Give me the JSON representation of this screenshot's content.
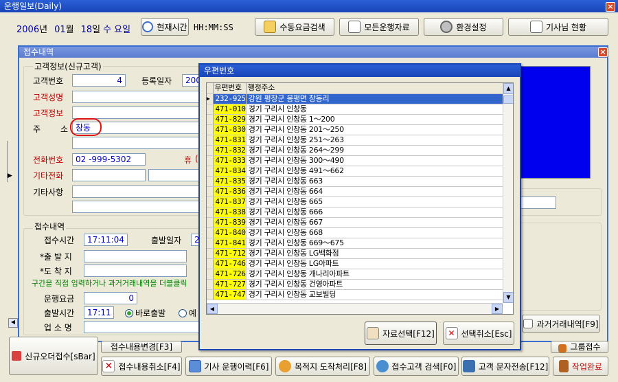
{
  "main_window": {
    "title": "운행일보(Daily)",
    "date": {
      "year": "2006",
      "year_unit": "년",
      "month": "01",
      "month_unit": "월",
      "day": "18",
      "day_unit": "일",
      "weekday": "수 요일"
    },
    "current_time_button": "현재시간",
    "time_display": "HH:MM:SS",
    "toolbar": [
      {
        "label": "수동요금검색",
        "icon": "wand-icon"
      },
      {
        "label": "모든운행자료",
        "icon": "document-icon"
      },
      {
        "label": "환경설정",
        "icon": "gear-icon"
      },
      {
        "label": "기사님 현황",
        "icon": "clipboard-icon"
      }
    ]
  },
  "reception_window": {
    "title": "접수내역",
    "customer_group": {
      "title": "고객정보(신규고객)",
      "customer_no_label": "고객번호",
      "customer_no": "4",
      "reg_date_label": "등록일자",
      "reg_date": "200",
      "name_label": "고객성명",
      "info_label": "고객정보",
      "address_label_a": "주",
      "address_label_b": "소",
      "address_value": "창동",
      "phone_label": "전화번호",
      "phone_value": "02  -999-5302",
      "mobile_label_partial": "휴",
      "mobile_value_partial": "(",
      "other_phone_label": "기타전화",
      "other_notes_label": "기타사항"
    },
    "reception_group": {
      "title": "접수내역",
      "time_label": "접수시간",
      "time_value": "17:11:04",
      "depart_date_label": "출발일자",
      "depart_date_partial": "2",
      "origin_label": "*출 발 지",
      "destination_label": "*도 착 지",
      "hint_text": "구간을 직접 입력하거나 과거거래내역을 더블클릭",
      "fare_label": "운행요금",
      "fare_value": "0",
      "depart_time_label": "출발시간",
      "depart_time_value": "17:11",
      "radio_now": "바로출발",
      "radio_reserve_partial": "예",
      "business_label": "업 소 명"
    },
    "history_button": "과거거래내역[F9]"
  },
  "bottom_bar": {
    "new_order": "신규오더접수[sBar]",
    "buttons_row1": [
      "접수내용변경[F3]",
      "그룹접수"
    ],
    "buttons_row2": [
      {
        "label": "접수내용취소[F4]",
        "icon": "cancel-icon"
      },
      {
        "label": "기사 운행이력[F6]",
        "icon": "calendar-icon"
      },
      {
        "label": "목적지 도착처리[F8]",
        "icon": "phone-icon"
      },
      {
        "label": "접수고객 검색[F0]",
        "icon": "search-person-icon"
      },
      {
        "label": "고객 문자전송[F12]",
        "icon": "message-icon"
      },
      {
        "label": "작업완료",
        "icon": "door-icon"
      }
    ]
  },
  "postal_dialog": {
    "title": "우편번호",
    "columns": [
      "우편번호",
      "행정주소"
    ],
    "rows": [
      {
        "code": "232-925",
        "address": "강원 평창군 봉평면 창동리",
        "selected": true
      },
      {
        "code": "471-010",
        "address": "경기 구리시 인창동"
      },
      {
        "code": "471-829",
        "address": "경기 구리시 인창동 1～200"
      },
      {
        "code": "471-830",
        "address": "경기 구리시 인창동 201～250"
      },
      {
        "code": "471-831",
        "address": "경기 구리시 인창동 251～263"
      },
      {
        "code": "471-832",
        "address": "경기 구리시 인창동 264～299"
      },
      {
        "code": "471-833",
        "address": "경기 구리시 인창동 300～490"
      },
      {
        "code": "471-834",
        "address": "경기 구리시 인창동 491～662"
      },
      {
        "code": "471-835",
        "address": "경기 구리시 인창동 663"
      },
      {
        "code": "471-836",
        "address": "경기 구리시 인창동 664"
      },
      {
        "code": "471-837",
        "address": "경기 구리시 인창동 665"
      },
      {
        "code": "471-838",
        "address": "경기 구리시 인창동 666"
      },
      {
        "code": "471-839",
        "address": "경기 구리시 인창동 667"
      },
      {
        "code": "471-840",
        "address": "경기 구리시 인창동 668"
      },
      {
        "code": "471-841",
        "address": "경기 구리시 인창동 669～675"
      },
      {
        "code": "471-712",
        "address": "경기 구리시 인창동 LG백화점"
      },
      {
        "code": "471-746",
        "address": "경기 구리시 인창동 LG아파트"
      },
      {
        "code": "471-726",
        "address": "경기 구리시 인창동 개나리아파트"
      },
      {
        "code": "471-727",
        "address": "경기 구리시 인창동 건영아파트"
      },
      {
        "code": "471-747",
        "address": "경기 구리시 인창동 교보빌딩"
      }
    ],
    "select_button": "자료선택[F12]",
    "cancel_button": "선택취소[Esc]"
  },
  "colors": {
    "titlebar": "#1945b8",
    "highlight": "#3366cc",
    "zip_cell": "#ffff00",
    "label_red": "#c00000",
    "value_blue": "#0000cc"
  }
}
